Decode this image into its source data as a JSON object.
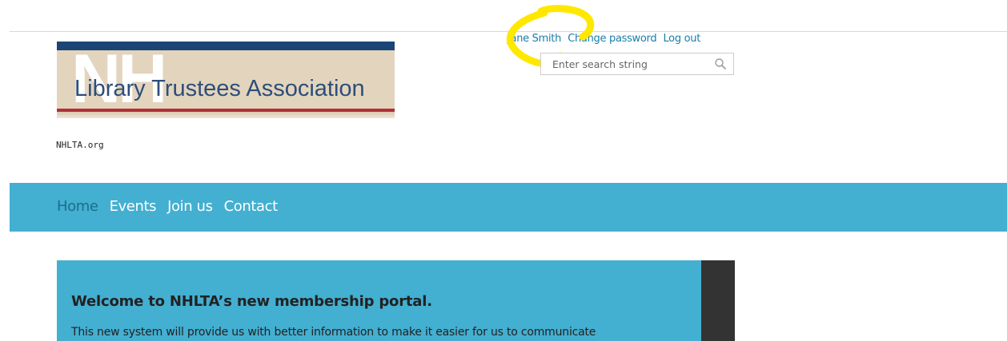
{
  "header": {
    "logo": {
      "monogram": "NH",
      "name": "Library Trustees Association"
    },
    "slogan": "NHLTA.org",
    "user_links": {
      "user_name": "Jane Smith",
      "change_password": "Change password",
      "log_out": "Log out"
    },
    "search": {
      "placeholder": "Enter search string",
      "icon": "search-icon"
    }
  },
  "nav": {
    "items": [
      {
        "label": "Home",
        "active": true
      },
      {
        "label": "Events",
        "active": false
      },
      {
        "label": "Join us",
        "active": false
      },
      {
        "label": "Contact",
        "active": false
      }
    ]
  },
  "main": {
    "welcome_title": "Welcome to NHLTA’s new membership portal.",
    "welcome_text": "This new system will provide us with better information to make it easier for us to communicate"
  },
  "colors": {
    "accent": "#43afd1",
    "link": "#1a7ea8",
    "nav_active": "#1b6f8e",
    "highlight": "#ffe800",
    "logo_navy": "#1b4575",
    "logo_red": "#b03038",
    "logo_beige": "#e3d4bd",
    "dark_panel": "#333333"
  }
}
